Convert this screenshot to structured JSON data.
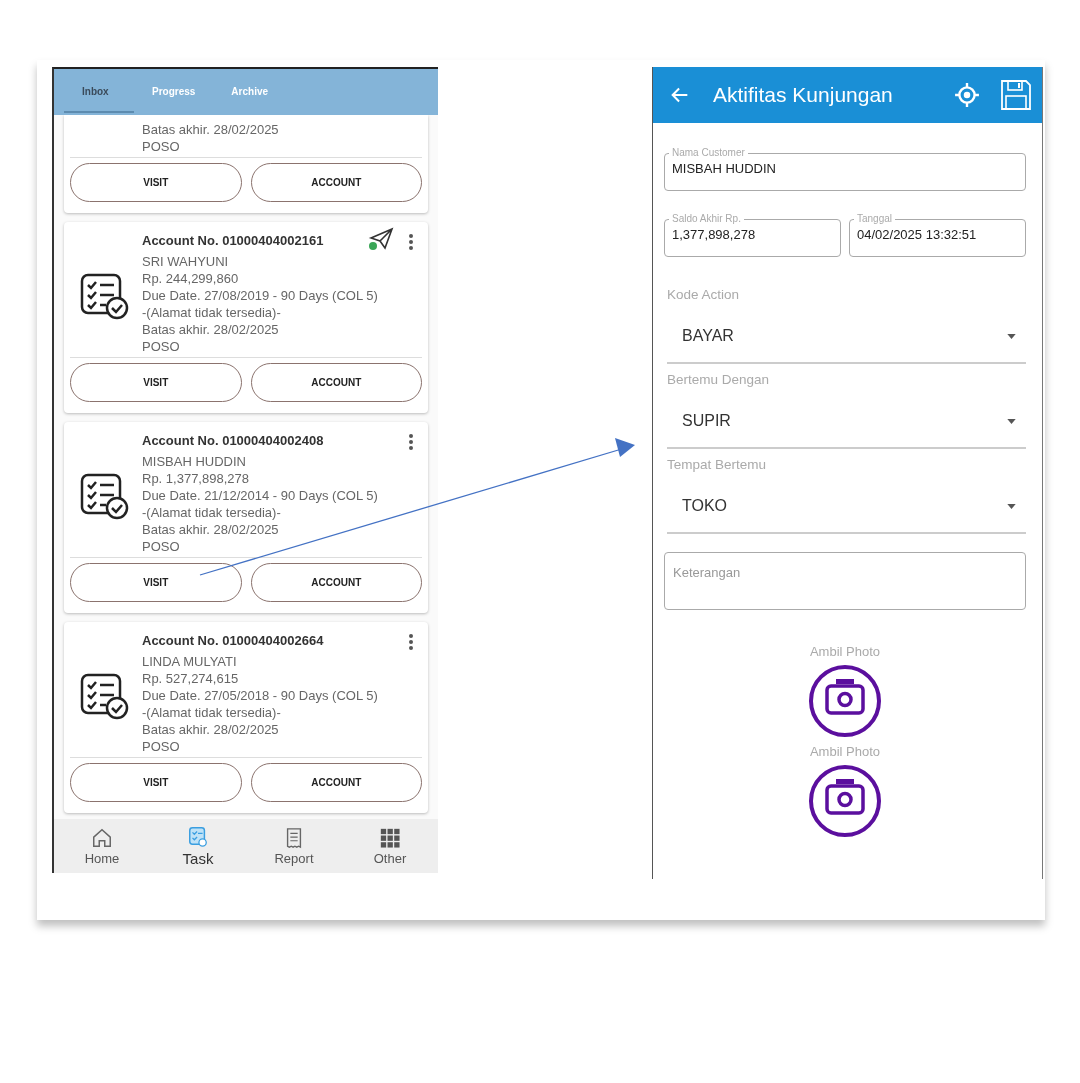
{
  "inbox_screen": {
    "tabs": [
      {
        "label": "Inbox",
        "selected": true
      },
      {
        "label": "Progress",
        "selected": false
      },
      {
        "label": "Archive",
        "selected": false
      }
    ],
    "cards": [
      {
        "lines": [
          "Batas akhir. 28/02/2025",
          "POSO"
        ],
        "buttons": [
          "VISIT",
          "ACCOUNT"
        ]
      },
      {
        "account": "Account No. 01000404002161",
        "sent": true,
        "lines": [
          "SRI WAHYUNI",
          "Rp. 244,299,860",
          "Due Date. 27/08/2019 - 90 Days (COL 5)",
          "-(Alamat tidak tersedia)-",
          "Batas akhir. 28/02/2025",
          "POSO"
        ],
        "buttons": [
          "VISIT",
          "ACCOUNT"
        ]
      },
      {
        "account": "Account No. 01000404002408",
        "sent": false,
        "lines": [
          "MISBAH HUDDIN",
          "Rp. 1,377,898,278",
          "Due Date. 21/12/2014 - 90 Days (COL 5)",
          "-(Alamat tidak tersedia)-",
          "Batas akhir. 28/02/2025",
          "POSO"
        ],
        "buttons": [
          "VISIT",
          "ACCOUNT"
        ]
      },
      {
        "account": "Account No. 01000404002664",
        "sent": false,
        "lines": [
          "LINDA MULYATI",
          "Rp. 527,274,615",
          "Due Date. 27/05/2018 - 90 Days (COL 5)",
          "-(Alamat tidak tersedia)-",
          "Batas akhir. 28/02/2025",
          "POSO"
        ],
        "buttons": [
          "VISIT",
          "ACCOUNT"
        ]
      }
    ],
    "bottom_nav": [
      {
        "label": "Home",
        "kind": "home",
        "selected": false
      },
      {
        "label": "Task",
        "kind": "task",
        "selected": true
      },
      {
        "label": "Report",
        "kind": "report",
        "selected": false
      },
      {
        "label": "Other",
        "kind": "grid",
        "selected": false
      }
    ]
  },
  "visit_screen": {
    "title": "Aktifitas Kunjungan",
    "field_rows": [
      [
        {
          "label": "Nama Customer",
          "value": "MISBAH HUDDIN"
        }
      ],
      [
        {
          "label": "Saldo Akhir Rp.",
          "value": "1,377,898,278"
        },
        {
          "label": "Tanggal",
          "value": "04/02/2025 13:32:51"
        }
      ]
    ],
    "selects": [
      {
        "label": "Kode Action",
        "value": "BAYAR"
      },
      {
        "label": "Bertemu Dengan",
        "value": "SUPIR"
      },
      {
        "label": "Tempat Bertemu",
        "value": "TOKO"
      }
    ],
    "notes": {
      "placeholder": "Keterangan"
    },
    "photos": [
      "Ambil Photo",
      "Ambil Photo"
    ]
  }
}
